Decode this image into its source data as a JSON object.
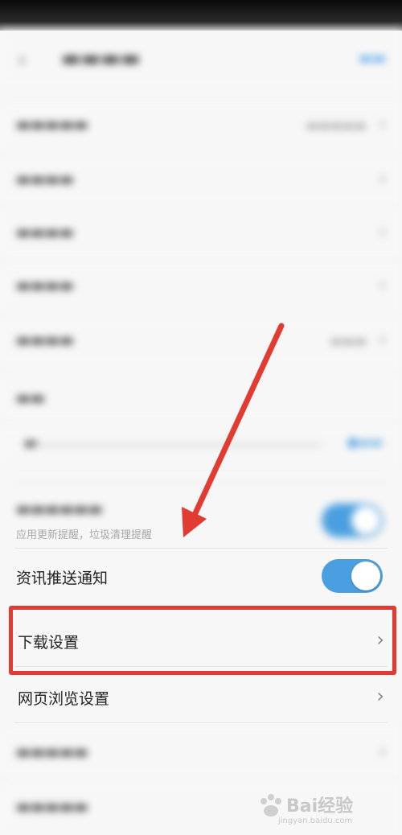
{
  "screen": {
    "sub_label": "应用更新提醒，垃圾清理提醒",
    "items": [
      {
        "label": "资讯推送通知",
        "toggle_on": true
      },
      {
        "label": "下载设置"
      },
      {
        "label": "网页浏览设置"
      }
    ]
  },
  "colors": {
    "accent": "#4a9fe0",
    "annotation": "#e23b32"
  },
  "watermark": {
    "brand": "Bai经验",
    "site": "jingyan.baidu.com"
  }
}
